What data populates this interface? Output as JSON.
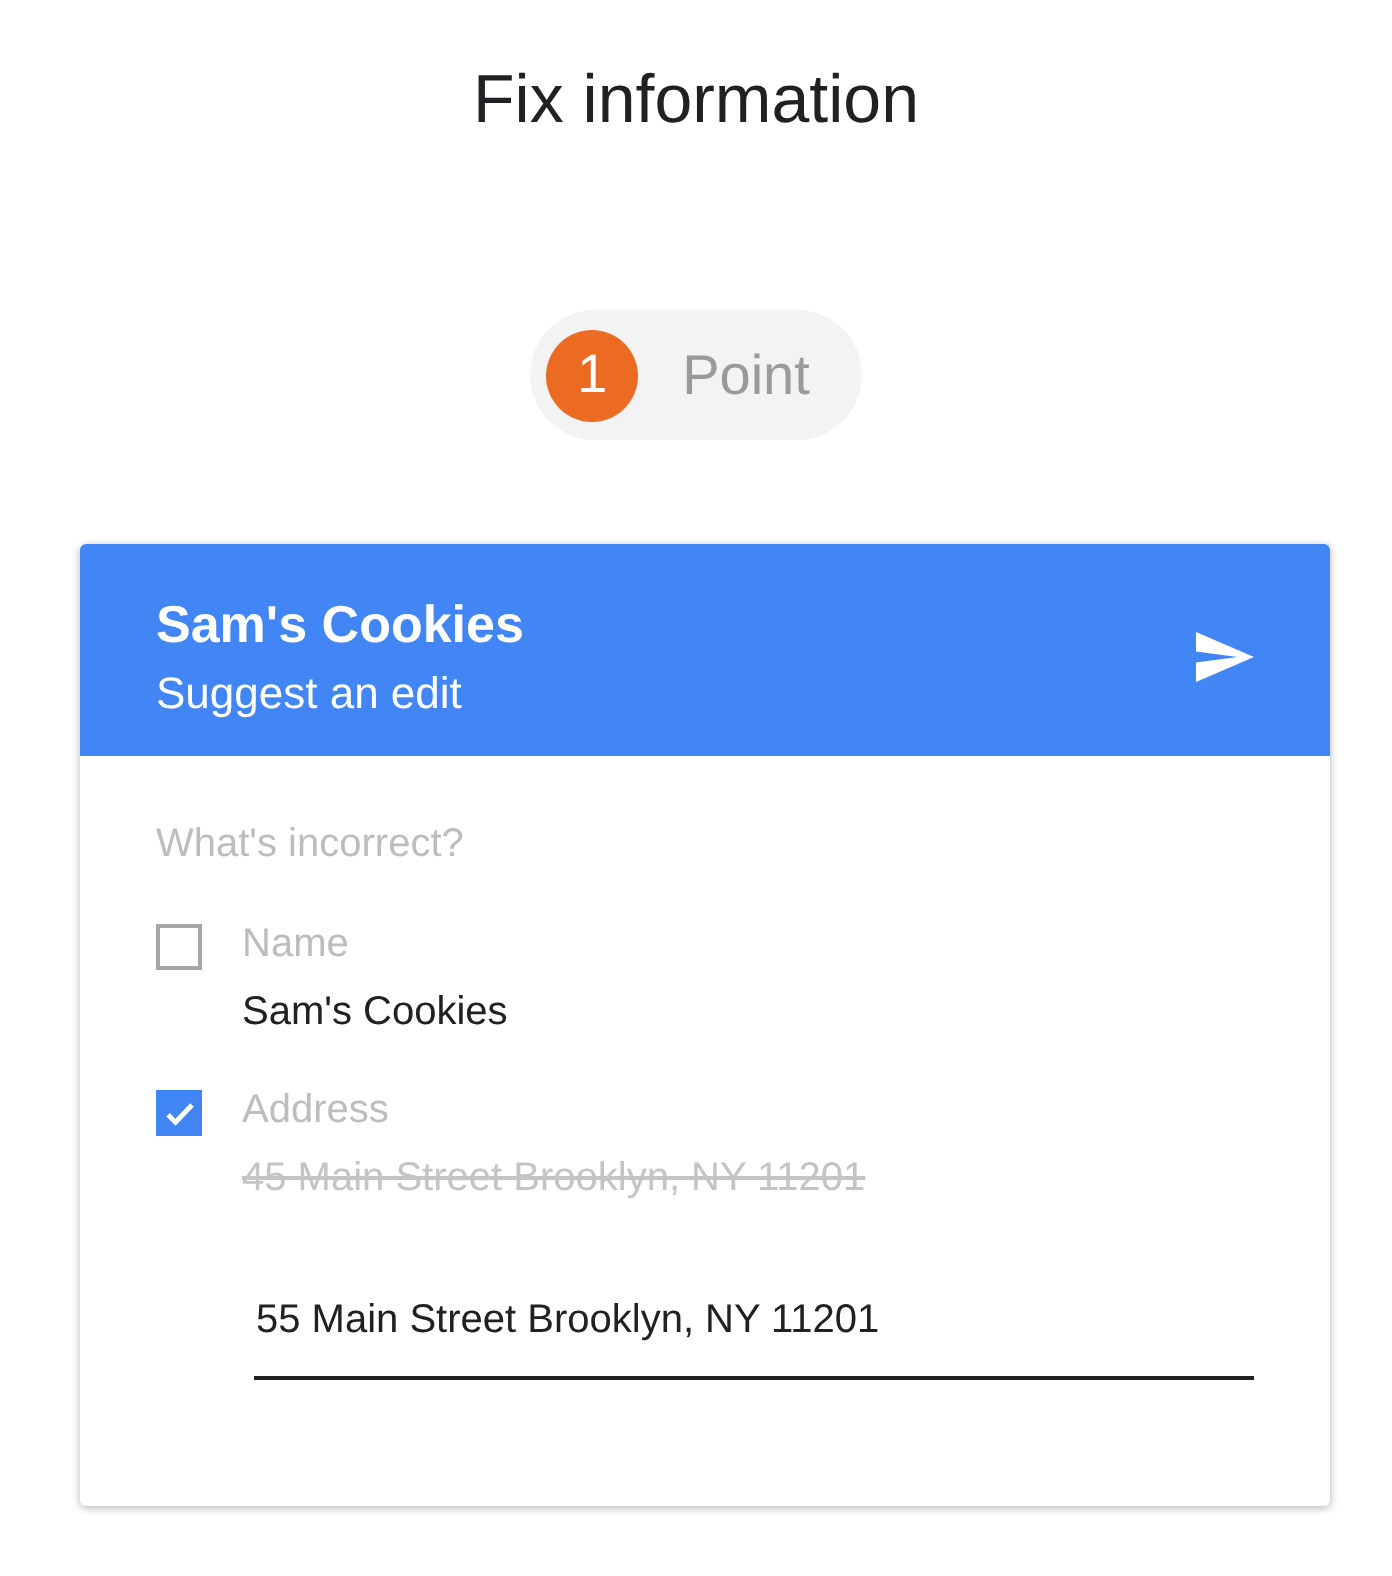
{
  "page": {
    "title": "Fix information"
  },
  "points_badge": {
    "count": "1",
    "label": "Point"
  },
  "card": {
    "title": "Sam's Cookies",
    "subtitle": "Suggest an edit",
    "prompt": "What's incorrect?",
    "fields": [
      {
        "label": "Name",
        "value": "Sam's Cookies",
        "checked": false
      },
      {
        "label": "Address",
        "value": "45 Main Street Brooklyn, NY 11201",
        "checked": true,
        "new_value": "55 Main Street Brooklyn, NY 11201"
      }
    ]
  }
}
